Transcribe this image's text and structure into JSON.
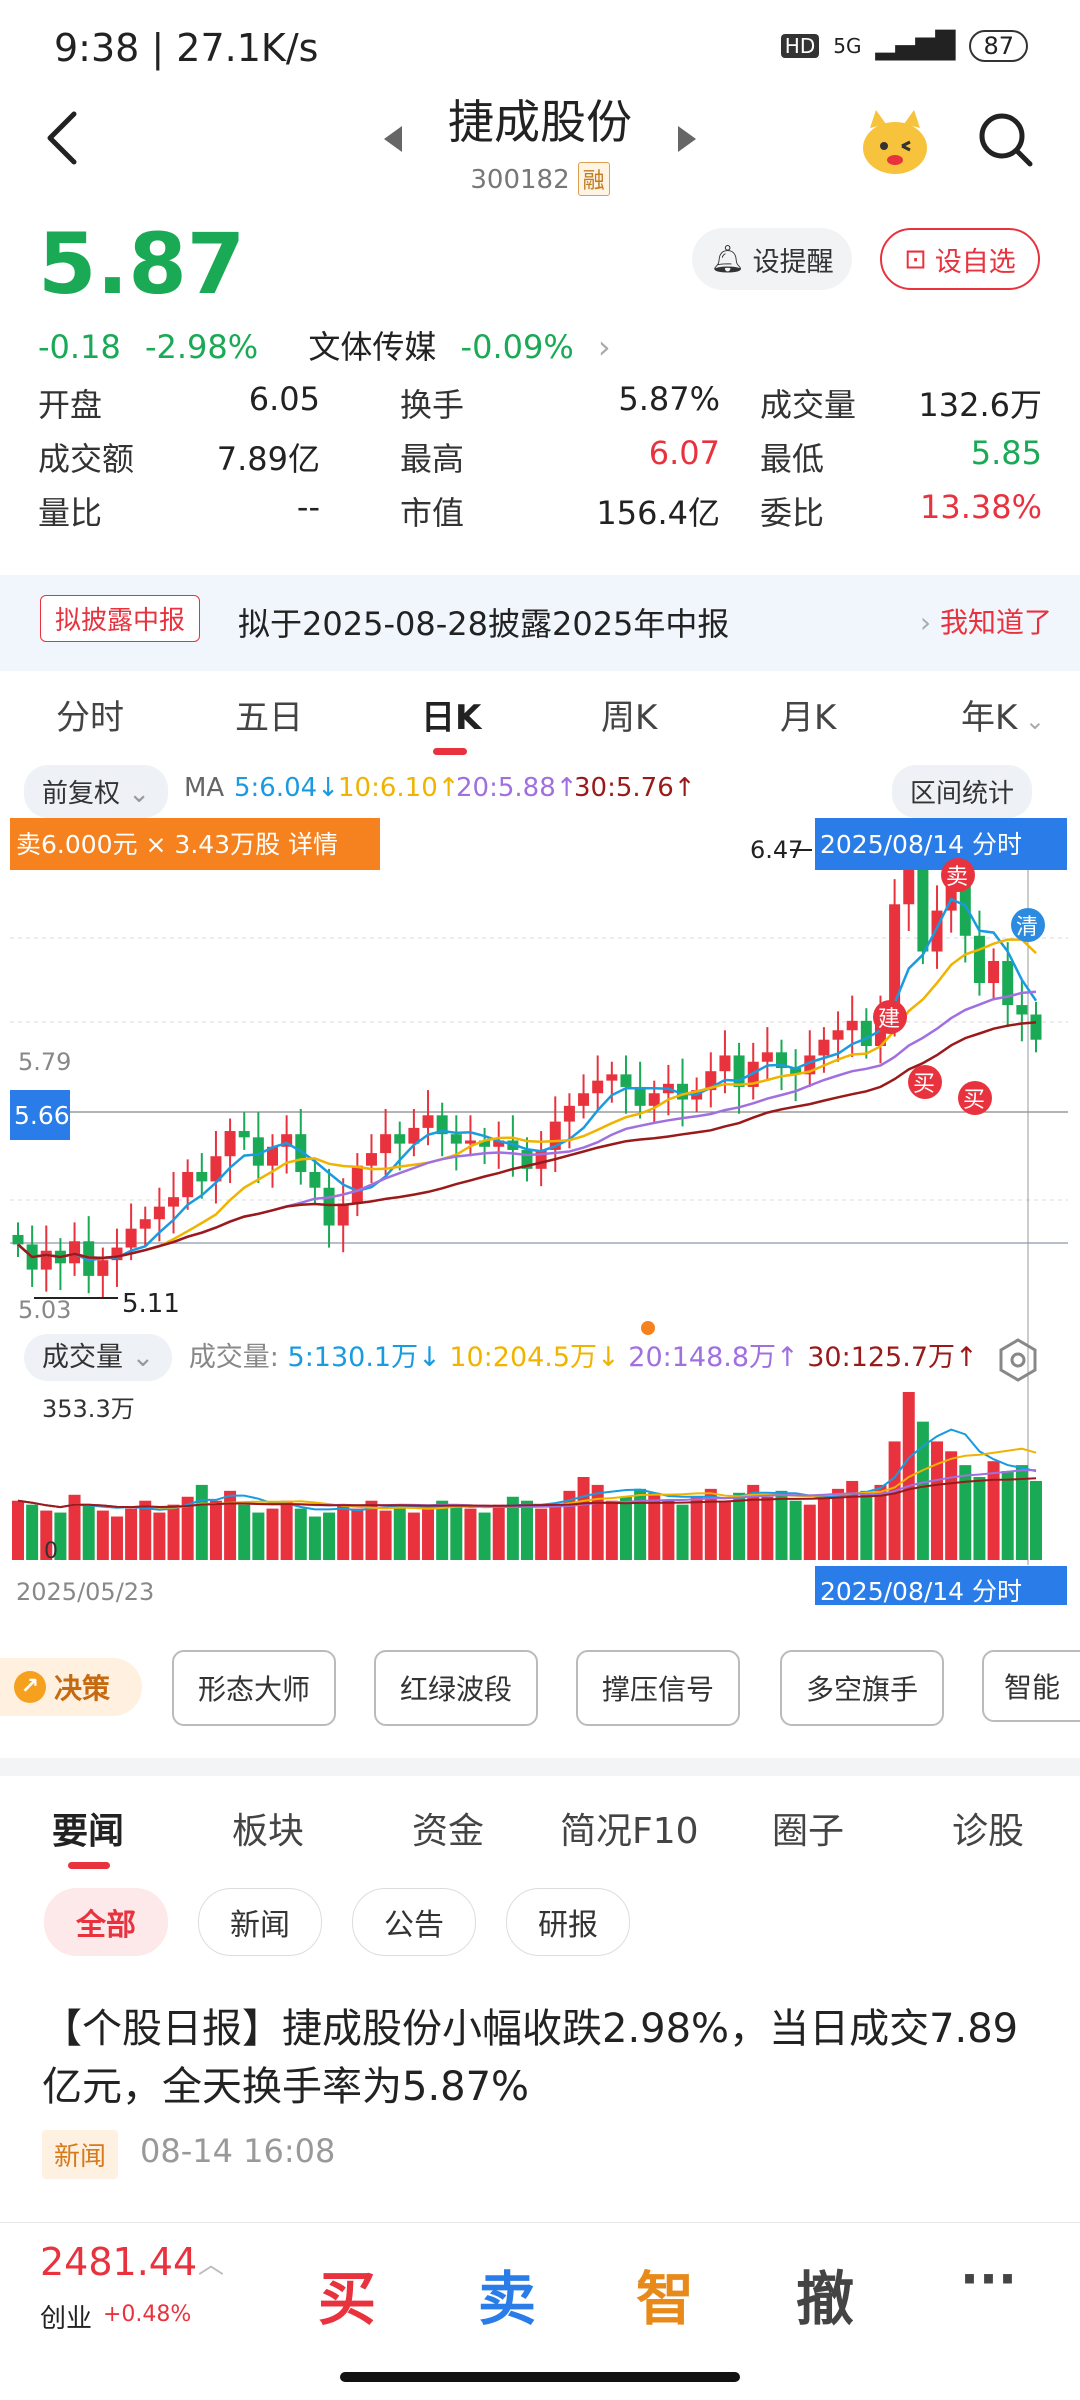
{
  "status": {
    "time": "9:38 | 27.1K/s",
    "hd": "HD",
    "net": "5G",
    "battery": "87"
  },
  "header": {
    "title": "捷成股份",
    "code": "300182",
    "margin_tag": "融"
  },
  "quote": {
    "price": "5.87",
    "change": "-0.18",
    "change_pct": "-2.98%",
    "sector": "文体传媒",
    "sector_pct": "-0.09%",
    "alert_label": "设提醒",
    "watch_label": "设自选"
  },
  "metrics": {
    "open_label": "开盘",
    "open": "6.05",
    "turnover_label": "换手",
    "turnover": "5.87%",
    "volume_label": "成交量",
    "volume": "132.6万",
    "amount_label": "成交额",
    "amount": "7.89亿",
    "high_label": "最高",
    "high": "6.07",
    "low_label": "最低",
    "low": "5.85",
    "ratio_label": "量比",
    "ratio": "--",
    "mcap_label": "市值",
    "mcap": "156.4亿",
    "bid_label": "委比",
    "bid": "13.38%"
  },
  "banner": {
    "tag": "拟披露中报",
    "text": "拟于2025-08-28披露2025年中报",
    "dismiss": "我知道了"
  },
  "period_tabs": [
    "分时",
    "五日",
    "日K",
    "周K",
    "月K",
    "年K"
  ],
  "ma_row": {
    "adj": "前复权",
    "ma": "MA",
    "ma5": "5:6.04↓",
    "ma10": "10:6.10↑",
    "ma20": "20:5.88↑",
    "ma30": "30:5.76↑",
    "range": "区间统计"
  },
  "chart_labels": {
    "trade_tip": "卖6.000元 × 3.43万股 详情",
    "high_mark": "6.47",
    "date_tag": "2025/08/14 分时",
    "y_579": "5.79",
    "y_566": "5.66",
    "y_503": "5.03",
    "low_mark": "5.11",
    "buy": "买",
    "sell": "卖",
    "build": "建",
    "clear": "清"
  },
  "volume": {
    "label": "成交量",
    "prefix": "成交量:",
    "ma5": "5:130.1万↓",
    "ma10": "10:204.5万↓",
    "ma20": "20:148.8万↑",
    "ma30": "30:125.7万↑",
    "max": "353.3万",
    "zero": "0",
    "start_date": "2025/05/23",
    "end_date": "2025/08/14 分时"
  },
  "tools": {
    "decide": "决策",
    "items": [
      "形态大师",
      "红绿波段",
      "撑压信号",
      "多空旗手",
      "智能"
    ]
  },
  "news_tabs": [
    "要闻",
    "板块",
    "资金",
    "简况F10",
    "圈子",
    "诊股"
  ],
  "news_filters": [
    "全部",
    "新闻",
    "公告",
    "研报"
  ],
  "news": {
    "headline": "【个股日报】捷成股份小幅收跌2.98%，当日成交7.89亿元，全天换手率为5.87%",
    "badge": "新闻",
    "time": "08-14 16:08"
  },
  "bottom": {
    "index_value": "2481.44",
    "index_name": "创业",
    "index_pct": "+0.48%",
    "buy": "买",
    "sell": "卖",
    "smart": "智",
    "cancel": "撤",
    "more": "···"
  },
  "colors": {
    "up": "#e8333f",
    "down": "#1aaa55",
    "ma5": "#1a9be0",
    "ma10": "#f0b400",
    "ma20": "#a070e0",
    "ma30": "#9a1a1a",
    "date_tag": "#2a7de8",
    "tip": "#f5821f"
  },
  "chart_data": {
    "type": "candlestick",
    "title": "",
    "period": "日K",
    "x_range": [
      "2025/05/23",
      "2025/08/14"
    ],
    "y_labels": [
      5.79,
      5.66,
      5.03
    ],
    "marked_high": 6.47,
    "marked_low": 5.11,
    "last_bar": {
      "date": "2025/08/14",
      "open": 6.05,
      "high": 6.07,
      "low": 5.85,
      "close": 5.87
    },
    "ma": {
      "MA5": 6.04,
      "MA10": 6.1,
      "MA20": 5.88,
      "MA30": 5.76
    },
    "closes": [
      5.22,
      5.14,
      5.2,
      5.16,
      5.23,
      5.12,
      5.17,
      5.21,
      5.27,
      5.3,
      5.34,
      5.37,
      5.45,
      5.42,
      5.5,
      5.58,
      5.56,
      5.47,
      5.53,
      5.57,
      5.45,
      5.4,
      5.28,
      5.35,
      5.47,
      5.51,
      5.57,
      5.54,
      5.59,
      5.63,
      5.57,
      5.54,
      5.55,
      5.53,
      5.55,
      5.52,
      5.46,
      5.52,
      5.61,
      5.66,
      5.7,
      5.74,
      5.76,
      5.72,
      5.66,
      5.7,
      5.73,
      5.68,
      5.71,
      5.77,
      5.82,
      5.72,
      5.8,
      5.83,
      5.78,
      5.76,
      5.82,
      5.87,
      5.9,
      5.93,
      5.85,
      5.95,
      6.3,
      6.45,
      6.15,
      6.28,
      6.4,
      6.2,
      6.05,
      6.12,
      5.98,
      5.95,
      5.87
    ],
    "volume": {
      "max_label": "353.3万",
      "values": [
        30,
        28,
        25,
        24,
        33,
        28,
        25,
        22,
        26,
        30,
        24,
        28,
        32,
        38,
        30,
        35,
        28,
        24,
        26,
        30,
        26,
        22,
        24,
        28,
        26,
        30,
        25,
        28,
        24,
        26,
        30,
        28,
        26,
        24,
        28,
        32,
        30,
        26,
        28,
        35,
        42,
        38,
        30,
        32,
        36,
        34,
        30,
        28,
        32,
        36,
        30,
        34,
        38,
        32,
        35,
        30,
        28,
        33,
        36,
        40,
        35,
        38,
        60,
        85,
        70,
        60,
        55,
        48,
        42,
        50,
        45,
        48,
        40
      ]
    }
  }
}
